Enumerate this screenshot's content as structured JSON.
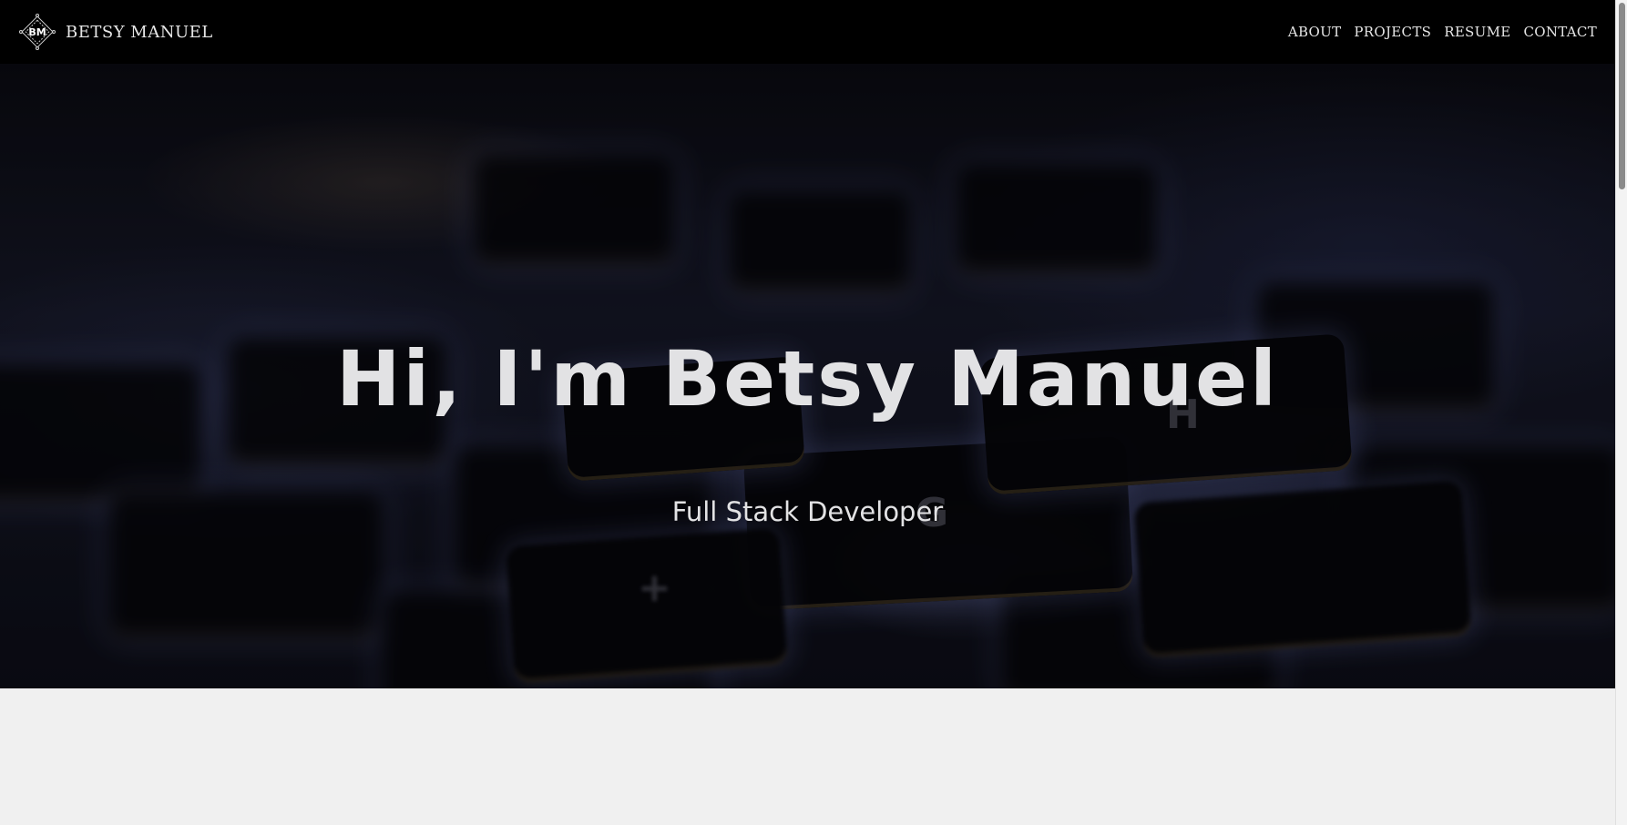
{
  "brand": {
    "logo_text": "BM",
    "name": "BETSY MANUEL"
  },
  "nav": {
    "items": [
      {
        "label": "ABOUT"
      },
      {
        "label": "PROJECTS"
      },
      {
        "label": "RESUME"
      },
      {
        "label": "CONTACT"
      }
    ]
  },
  "hero": {
    "title": "Hi, I'm Betsy Manuel",
    "subtitle": "Full Stack Developer",
    "background": "keyboard-photo"
  },
  "colors": {
    "navbar": "#000000",
    "page_background": "#f0f0f0",
    "hero_text": "#e2e2e4"
  }
}
